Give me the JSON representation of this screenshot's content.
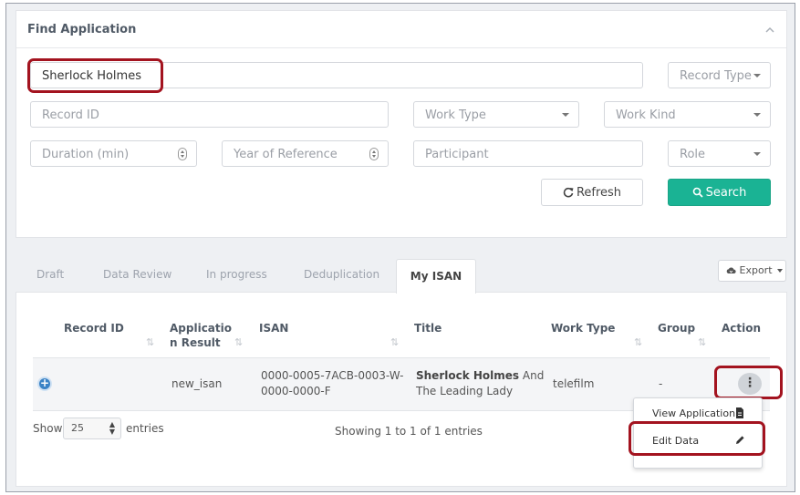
{
  "find_panel": {
    "title": "Find Application",
    "search_value": "Sherlock Holmes",
    "record_type_placeholder": "Record Type",
    "record_id_placeholder": "Record ID",
    "work_type_placeholder": "Work Type",
    "work_kind_placeholder": "Work Kind",
    "duration_placeholder": "Duration (min)",
    "year_placeholder": "Year of Reference",
    "participant_placeholder": "Participant",
    "role_placeholder": "Role",
    "refresh_label": "Refresh",
    "search_label": "Search"
  },
  "tabs": {
    "draft": "Draft",
    "data_review": "Data Review",
    "in_progress": "In progress",
    "deduplication": "Deduplication",
    "my_isan": "My ISAN",
    "active": "My ISAN"
  },
  "export_label": "Export",
  "table": {
    "headers": {
      "record_id": "Record ID",
      "application_result_line1": "Applicatio",
      "application_result_line2": "n Result",
      "isan": "ISAN",
      "title": "Title",
      "work_type": "Work Type",
      "group": "Group",
      "action": "Action"
    },
    "rows": [
      {
        "record_id": "",
        "application_result": "new_isan",
        "isan_line1": "0000-0005-7ACB-0003-W-",
        "isan_line2": "0000-0000-F",
        "title_bold": "Sherlock Holmes",
        "title_rest": " And",
        "title_line2": "The Leading Lady",
        "work_type": "telefilm",
        "group": "-"
      }
    ]
  },
  "row_menu": {
    "view_application": "View Application",
    "edit_data": "Edit Data"
  },
  "footer": {
    "show_label": "Show",
    "page_length": "25",
    "entries_label": "entries",
    "summary": "Showing 1 to 1 of 1 entries"
  },
  "colors": {
    "accent": "#1ab394",
    "highlight": "#a3131f",
    "expand_button": "#3b83c6"
  }
}
